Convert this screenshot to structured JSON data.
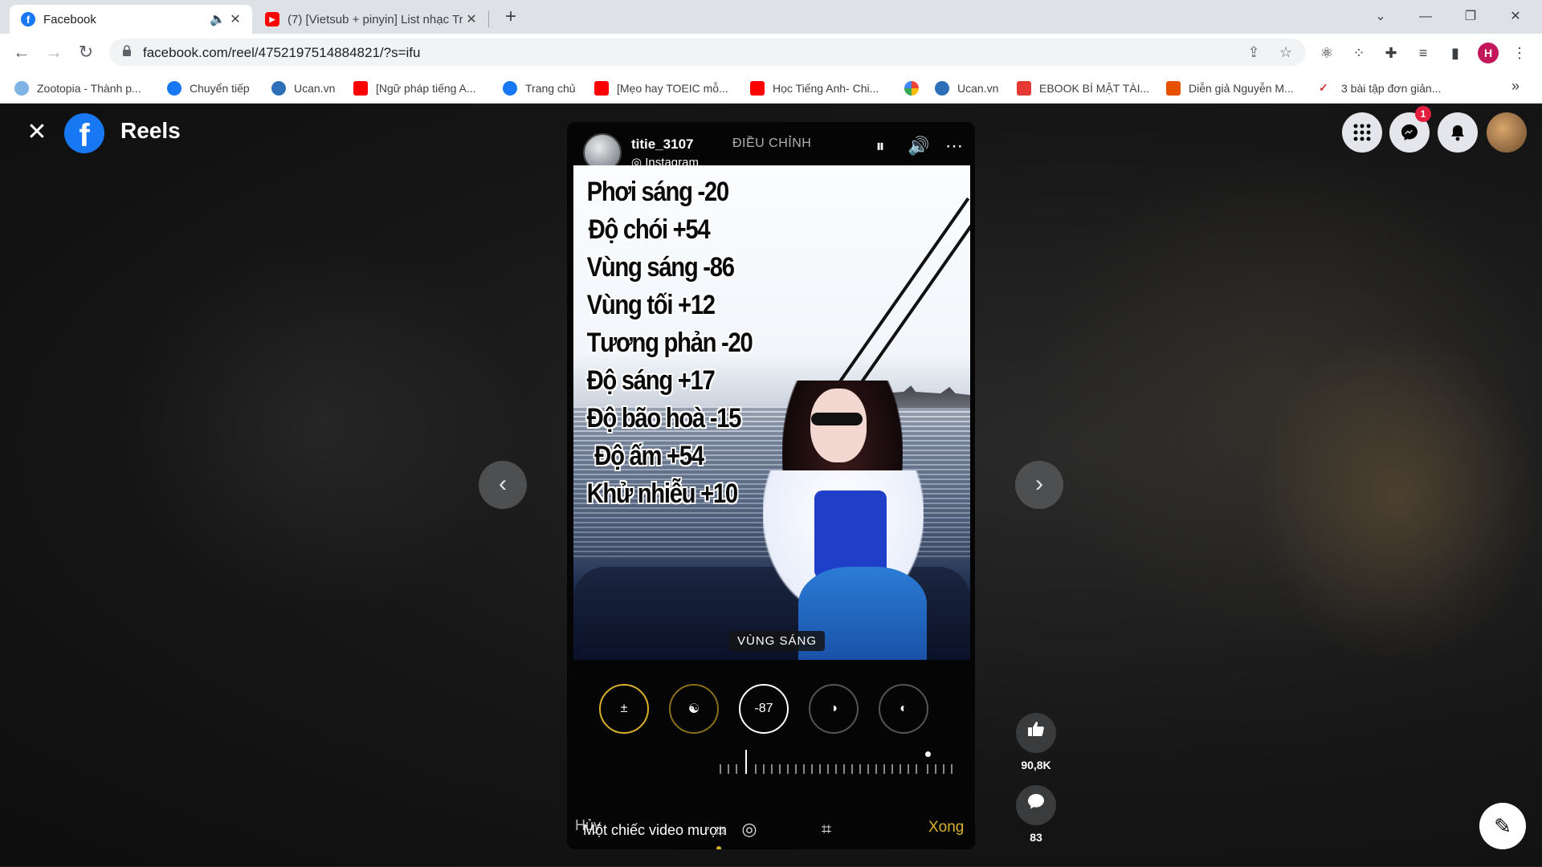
{
  "browser": {
    "tabs": [
      {
        "title": "Facebook",
        "active": true
      },
      {
        "title": "(7) [Vietsub + pinyin] List nhạc Tr",
        "active": false
      }
    ],
    "url": "facebook.com/reel/4752197514884821/?s=ifu",
    "profile_initial": "H",
    "bookmarks": [
      {
        "label": "Zootopia - Thành p...",
        "icon": "zootopia-icon"
      },
      {
        "label": "Chuyển tiếp",
        "icon": "facebook-icon"
      },
      {
        "label": "Ucan.vn",
        "icon": "ucan-icon"
      },
      {
        "label": "[Ngữ pháp tiếng A...",
        "icon": "youtube-icon"
      },
      {
        "label": "Trang chủ",
        "icon": "facebook-icon"
      },
      {
        "label": "[Mẹo hay TOEIC mỗ...",
        "icon": "youtube-icon"
      },
      {
        "label": "Học Tiếng Anh- Chi...",
        "icon": "youtube-icon"
      },
      {
        "label": "",
        "icon": "pinwheel-icon"
      },
      {
        "label": "Ucan.vn",
        "icon": "ucan-icon"
      },
      {
        "label": "EBOOK BÍ MẬT TÀI...",
        "icon": "pdf-icon"
      },
      {
        "label": "Diễn giả Nguyễn M...",
        "icon": "calendar-icon"
      },
      {
        "label": "3 bài tập đơn giản...",
        "icon": "check-icon"
      }
    ],
    "bookmarks_more": "»"
  },
  "page": {
    "title": "Reels",
    "messenger_badge": "1"
  },
  "reel": {
    "username": "titie_3107",
    "source": "Instagram",
    "header_label": "ĐIỀU CHỈNH",
    "overlay_lines": [
      "Phơi sáng -20",
      "Độ chói +54",
      "Vùng sáng -86",
      "Vùng tối +12",
      "Tương phản -20",
      "Độ sáng +17",
      "Độ bão hoà -15",
      "Độ ấm +54",
      "Khử nhiễu +10"
    ],
    "video_label": "VÙNG SÁNG",
    "active_dial_value": "-87",
    "cancel_label": "Hủy",
    "caption": "Một chiếc video mượn",
    "done_label": "Xong"
  },
  "actions": {
    "likes": "90,8K",
    "comments": "83"
  },
  "colors": {
    "facebook_blue": "#1877f2",
    "accent_gold": "#d9b12a",
    "badge_red": "#e41e3f"
  }
}
